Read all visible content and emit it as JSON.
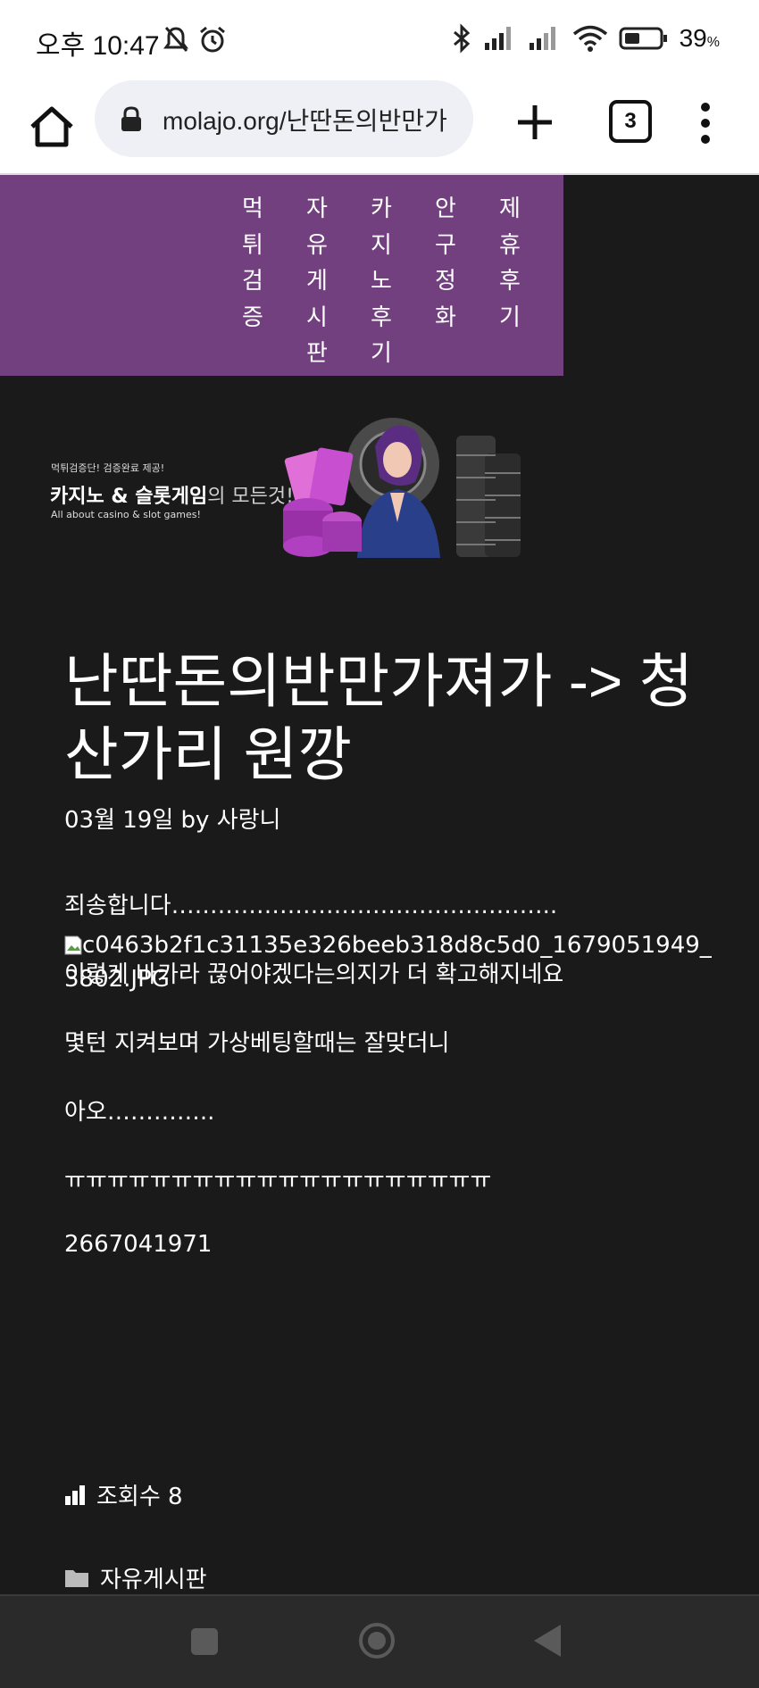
{
  "status_bar": {
    "time": "오후 10:47",
    "battery": "39",
    "battery_unit": "%"
  },
  "browser": {
    "url": "molajo.org/난딴돈의반만가",
    "tab_count": "3"
  },
  "site_nav": {
    "items": [
      {
        "label": "먹튀검증",
        "lines": [
          "먹",
          "튀",
          "검",
          "증"
        ]
      },
      {
        "label": "자유게시판",
        "lines": [
          "자",
          "유",
          "게",
          "시",
          "판"
        ]
      },
      {
        "label": "카지노후기",
        "lines": [
          "카",
          "지",
          "노",
          "후",
          "기"
        ]
      },
      {
        "label": "안구정화",
        "lines": [
          "안",
          "구",
          "정",
          "화"
        ]
      },
      {
        "label": "제휴후기",
        "lines": [
          "제",
          "휴",
          "후",
          "기"
        ]
      }
    ]
  },
  "banner": {
    "tagline": "먹튀검증단! 검증완료 제공!",
    "headline": "카지노 & 슬롯게임",
    "headline_suffix": "의 모든것!",
    "subtitle_en": "All about casino & slot games!"
  },
  "post": {
    "title": "난딴돈의반만가져가 -> 청산가리 원깡",
    "meta": "03월 19일 by 사랑니",
    "image_alt": "c0463b2f1c31135e326beeb318d8c5d0_1679051949_3802.JPG",
    "paragraphs": [
      "죄송합니다…………………………………………..",
      "이렇게 바카라 끊어야겠다는의지가 더 확고해지네요",
      "몇턴 지켜보며 가상베팅할때는 잘맞더니",
      "아오…………..",
      "ㅠㅠㅠㅠㅠㅠㅠㅠㅠㅠㅠㅠㅠㅠㅠㅠㅠㅠㅠㅠ",
      "2667041971"
    ],
    "views": "조회수 8",
    "category": "자유게시판"
  },
  "colors": {
    "nav_bg": "#72407e",
    "page_bg": "#1a1a1a"
  }
}
